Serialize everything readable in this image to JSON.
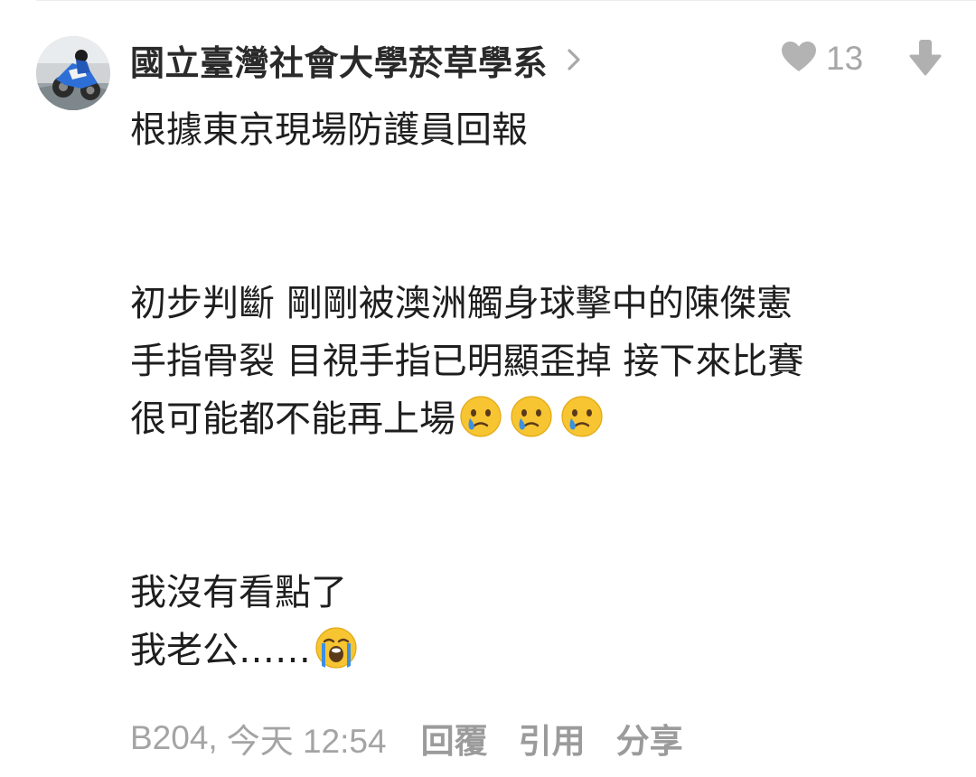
{
  "author": {
    "name": "國立臺灣社會大學菸草學系",
    "avatar_icon": "motorcycle-racer-avatar",
    "chevron_icon": "chevron-right-icon"
  },
  "reactions": {
    "like_icon": "heart-icon",
    "like_count": "13",
    "dislike_icon": "thumb-down-arrow-icon"
  },
  "content": {
    "lines": [
      "根據東京現場防護員回報",
      "",
      "初步判斷 剛剛被澳洲觸身球擊中的陳傑憲",
      "手指骨裂 目視手指已明顯歪掉 接下來比賽",
      "很可能都不能再上場",
      "",
      "我沒有看點了",
      "我老公……"
    ],
    "line5_emojis": [
      "face-holding-back-tears-emoji",
      "face-holding-back-tears-emoji",
      "face-holding-back-tears-emoji"
    ],
    "line8_emojis": [
      "loudly-crying-face-emoji"
    ]
  },
  "meta": {
    "floor": "B204,",
    "time": "今天 12:54",
    "reply_label": "回覆",
    "quote_label": "引用",
    "share_label": "分享"
  },
  "colors": {
    "text": "#1e1e1e",
    "muted": "#a4a4a4",
    "icon_gray": "#b0b0b0",
    "emoji_yellow": "#f7c531",
    "tear_blue": "#3d8fe0"
  }
}
